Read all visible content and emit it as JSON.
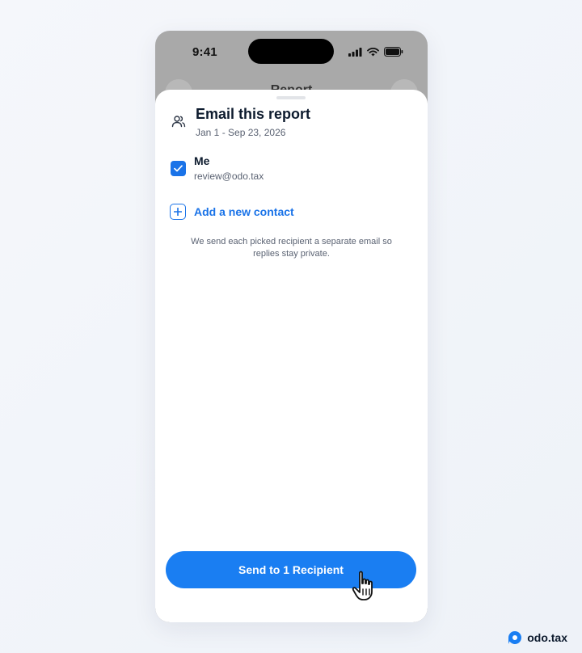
{
  "status_bar": {
    "time": "9:41"
  },
  "background_nav": {
    "title": "Report",
    "back_icon": "chevron-left-icon"
  },
  "sheet": {
    "title": "Email this report",
    "subtitle": "Jan 1 - Sep 23, 2026",
    "header_icon": "people-icon",
    "recipients": [
      {
        "name": "Me",
        "email": "review@odo.tax",
        "checked": true
      }
    ],
    "add_contact_label": "Add a new contact",
    "note": "We send each picked recipient a separate email so replies stay private.",
    "send_button_label": "Send to 1 Recipient"
  },
  "brand": {
    "name": "odo.tax"
  },
  "colors": {
    "accent": "#1a7ef2",
    "text": "#0d1b2e",
    "muted": "#5a6272"
  }
}
